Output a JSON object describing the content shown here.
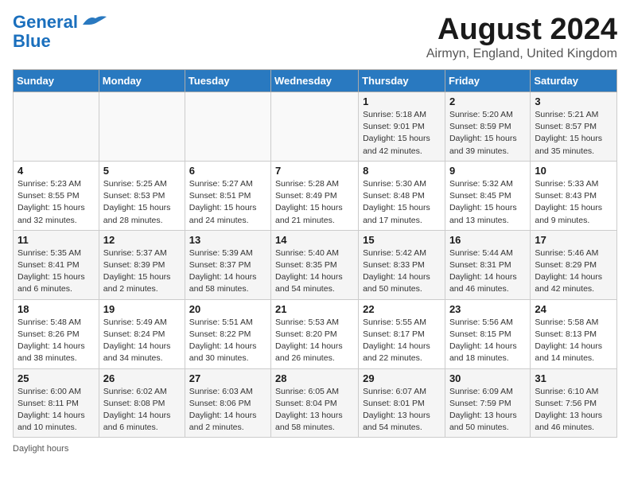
{
  "header": {
    "logo_line1": "General",
    "logo_line2": "Blue",
    "month": "August 2024",
    "location": "Airmyn, England, United Kingdom"
  },
  "days_of_week": [
    "Sunday",
    "Monday",
    "Tuesday",
    "Wednesday",
    "Thursday",
    "Friday",
    "Saturday"
  ],
  "weeks": [
    [
      {
        "day": "",
        "info": ""
      },
      {
        "day": "",
        "info": ""
      },
      {
        "day": "",
        "info": ""
      },
      {
        "day": "",
        "info": ""
      },
      {
        "day": "1",
        "info": "Sunrise: 5:18 AM\nSunset: 9:01 PM\nDaylight: 15 hours and 42 minutes."
      },
      {
        "day": "2",
        "info": "Sunrise: 5:20 AM\nSunset: 8:59 PM\nDaylight: 15 hours and 39 minutes."
      },
      {
        "day": "3",
        "info": "Sunrise: 5:21 AM\nSunset: 8:57 PM\nDaylight: 15 hours and 35 minutes."
      }
    ],
    [
      {
        "day": "4",
        "info": "Sunrise: 5:23 AM\nSunset: 8:55 PM\nDaylight: 15 hours and 32 minutes."
      },
      {
        "day": "5",
        "info": "Sunrise: 5:25 AM\nSunset: 8:53 PM\nDaylight: 15 hours and 28 minutes."
      },
      {
        "day": "6",
        "info": "Sunrise: 5:27 AM\nSunset: 8:51 PM\nDaylight: 15 hours and 24 minutes."
      },
      {
        "day": "7",
        "info": "Sunrise: 5:28 AM\nSunset: 8:49 PM\nDaylight: 15 hours and 21 minutes."
      },
      {
        "day": "8",
        "info": "Sunrise: 5:30 AM\nSunset: 8:48 PM\nDaylight: 15 hours and 17 minutes."
      },
      {
        "day": "9",
        "info": "Sunrise: 5:32 AM\nSunset: 8:45 PM\nDaylight: 15 hours and 13 minutes."
      },
      {
        "day": "10",
        "info": "Sunrise: 5:33 AM\nSunset: 8:43 PM\nDaylight: 15 hours and 9 minutes."
      }
    ],
    [
      {
        "day": "11",
        "info": "Sunrise: 5:35 AM\nSunset: 8:41 PM\nDaylight: 15 hours and 6 minutes."
      },
      {
        "day": "12",
        "info": "Sunrise: 5:37 AM\nSunset: 8:39 PM\nDaylight: 15 hours and 2 minutes."
      },
      {
        "day": "13",
        "info": "Sunrise: 5:39 AM\nSunset: 8:37 PM\nDaylight: 14 hours and 58 minutes."
      },
      {
        "day": "14",
        "info": "Sunrise: 5:40 AM\nSunset: 8:35 PM\nDaylight: 14 hours and 54 minutes."
      },
      {
        "day": "15",
        "info": "Sunrise: 5:42 AM\nSunset: 8:33 PM\nDaylight: 14 hours and 50 minutes."
      },
      {
        "day": "16",
        "info": "Sunrise: 5:44 AM\nSunset: 8:31 PM\nDaylight: 14 hours and 46 minutes."
      },
      {
        "day": "17",
        "info": "Sunrise: 5:46 AM\nSunset: 8:29 PM\nDaylight: 14 hours and 42 minutes."
      }
    ],
    [
      {
        "day": "18",
        "info": "Sunrise: 5:48 AM\nSunset: 8:26 PM\nDaylight: 14 hours and 38 minutes."
      },
      {
        "day": "19",
        "info": "Sunrise: 5:49 AM\nSunset: 8:24 PM\nDaylight: 14 hours and 34 minutes."
      },
      {
        "day": "20",
        "info": "Sunrise: 5:51 AM\nSunset: 8:22 PM\nDaylight: 14 hours and 30 minutes."
      },
      {
        "day": "21",
        "info": "Sunrise: 5:53 AM\nSunset: 8:20 PM\nDaylight: 14 hours and 26 minutes."
      },
      {
        "day": "22",
        "info": "Sunrise: 5:55 AM\nSunset: 8:17 PM\nDaylight: 14 hours and 22 minutes."
      },
      {
        "day": "23",
        "info": "Sunrise: 5:56 AM\nSunset: 8:15 PM\nDaylight: 14 hours and 18 minutes."
      },
      {
        "day": "24",
        "info": "Sunrise: 5:58 AM\nSunset: 8:13 PM\nDaylight: 14 hours and 14 minutes."
      }
    ],
    [
      {
        "day": "25",
        "info": "Sunrise: 6:00 AM\nSunset: 8:11 PM\nDaylight: 14 hours and 10 minutes."
      },
      {
        "day": "26",
        "info": "Sunrise: 6:02 AM\nSunset: 8:08 PM\nDaylight: 14 hours and 6 minutes."
      },
      {
        "day": "27",
        "info": "Sunrise: 6:03 AM\nSunset: 8:06 PM\nDaylight: 14 hours and 2 minutes."
      },
      {
        "day": "28",
        "info": "Sunrise: 6:05 AM\nSunset: 8:04 PM\nDaylight: 13 hours and 58 minutes."
      },
      {
        "day": "29",
        "info": "Sunrise: 6:07 AM\nSunset: 8:01 PM\nDaylight: 13 hours and 54 minutes."
      },
      {
        "day": "30",
        "info": "Sunrise: 6:09 AM\nSunset: 7:59 PM\nDaylight: 13 hours and 50 minutes."
      },
      {
        "day": "31",
        "info": "Sunrise: 6:10 AM\nSunset: 7:56 PM\nDaylight: 13 hours and 46 minutes."
      }
    ]
  ],
  "footer": {
    "note": "Daylight hours"
  }
}
